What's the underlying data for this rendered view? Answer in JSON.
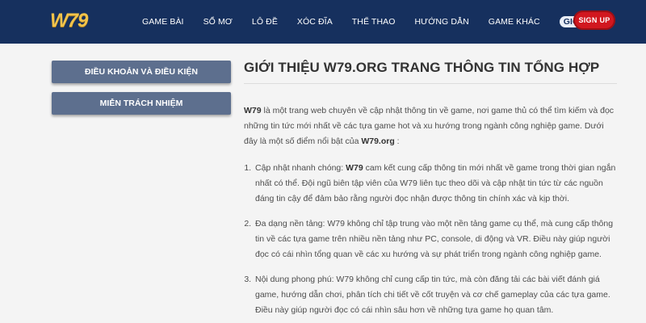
{
  "header": {
    "logo": "W79",
    "nav": [
      "Game Bài",
      "Sổ Mơ",
      "Lô Đề",
      "Xóc Đĩa",
      "Thể Thao",
      "Hướng Dẫn",
      "Game Khác",
      "Giới Thiệu"
    ],
    "active_nav": "Giới Thiệu",
    "signup_label": "SIGN UP",
    "colors": {
      "bar": "#16305e",
      "signup": "#d1171f",
      "logo": "#f2c34a"
    }
  },
  "sidebar": {
    "items": [
      "Điều khoản và điều kiện",
      "Miễn trách nhiệm"
    ]
  },
  "main": {
    "title": "Giới thiệu W79.org trang thông tin tổng hợp",
    "intro": {
      "brand": "W79",
      "text": " là một trang web chuyên về cập nhật thông tin về game, nơi game thủ có thể tìm kiếm và đọc những tin tức mới nhất về các tựa game hot và xu hướng trong ngành công nghiệp game. Dưới đây là một số điểm nổi bật của ",
      "site": "W79.org",
      "end": " :"
    },
    "list": [
      {
        "lead": "Cập nhật nhanh chóng: ",
        "brand": "W79",
        "text": " cam kết cung cấp thông tin mới nhất về game trong thời gian ngắn nhất có thể. Đội ngũ biên tập viên của W79 liên tục theo dõi và cập nhật tin tức từ các nguồn đáng tin cậy để đảm bảo rằng người đọc nhận được thông tin chính xác và kịp thời."
      },
      {
        "lead": "Đa dạng nền tảng: ",
        "text": "W79 không chỉ tập trung vào một nền tảng game cụ thể, mà cung cấp thông tin về các tựa game trên nhiều nền tảng như PC, console, di động và VR. Điều này giúp người đọc có cái nhìn tổng quan về các xu hướng và sự phát triển trong ngành công nghiệp game."
      },
      {
        "lead": "Nội dung phong phú: ",
        "text": "W79 không chỉ cung cấp tin tức, mà còn đăng tải các bài viết đánh giá game, hướng dẫn chơi, phân tích chi tiết về cốt truyện và cơ chế gameplay của các tựa game. Điều này giúp người đọc có cái nhìn sâu hơn về những tựa game họ quan tâm."
      }
    ]
  }
}
